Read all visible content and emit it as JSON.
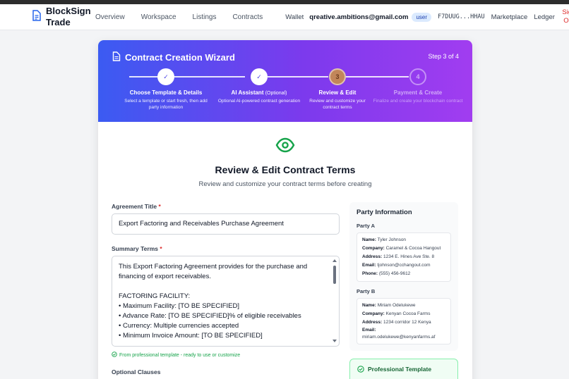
{
  "nav": {
    "brand": "BlockSign Trade",
    "links": [
      "Overview",
      "Workspace",
      "Listings",
      "Contracts"
    ],
    "wallet": "Wallet",
    "email": "qreative.ambitions@gmail.com",
    "role": "user",
    "address": "F7DUUG...HHAU",
    "marketplace": "Marketplace",
    "ledger": "Ledger",
    "signout": "Sign Out"
  },
  "wizard": {
    "title": "Contract Creation Wizard",
    "step_of": "Step 3 of 4",
    "steps": [
      {
        "num": "✓",
        "title": "Choose Template & Details",
        "note": "",
        "desc": "Select a template or start fresh, then add party information"
      },
      {
        "num": "✓",
        "title": "AI Assistant",
        "note": "(Optional)",
        "desc": "Optional AI-powered contract generation"
      },
      {
        "num": "3",
        "title": "Review & Edit",
        "note": "",
        "desc": "Review and customize your contract terms"
      },
      {
        "num": "4",
        "title": "Payment & Create",
        "note": "",
        "desc": "Finalize and create your blockchain contract"
      }
    ]
  },
  "review": {
    "title": "Review & Edit Contract Terms",
    "subtitle": "Review and customize your contract terms before creating",
    "agreement_label": "Agreement Title",
    "agreement_value": "Export Factoring and Receivables Purchase Agreement",
    "summary_label": "Summary Terms",
    "summary_lines": [
      "This Export Factoring Agreement provides for the purchase and",
      "financing of export receivables.",
      "",
      "FACTORING FACILITY:",
      "• Maximum Facility: [TO BE SPECIFIED]",
      "• Advance Rate: [TO BE SPECIFIED]% of eligible receivables",
      "• Currency: Multiple currencies accepted",
      "• Minimum Invoice Amount: [TO BE SPECIFIED]"
    ],
    "template_hint": "From professional template - ready to use or customize",
    "optional_clauses": "Optional Clauses",
    "required_mark": "*"
  },
  "party_info": {
    "title": "Party Information",
    "party_a": {
      "label": "Party A",
      "name_k": "Name:",
      "name": "Tyler Johnson",
      "company_k": "Company:",
      "company": "Caramel & Cocoa Hangout",
      "address_k": "Address:",
      "address": "1234 E. Hines Ave Ste. 8",
      "email_k": "Email:",
      "email": "tjohnson@cchangout.com",
      "phone_k": "Phone:",
      "phone": "(555) 456-9612"
    },
    "party_b": {
      "label": "Party B",
      "name_k": "Name:",
      "name": "Miriam Odelukewe",
      "company_k": "Company:",
      "company": "Kenyan Cocoa Farms",
      "address_k": "Address:",
      "address": "1234 corridor 12 Kenya",
      "email_k": "Email:",
      "email": "miriam.odelukewe@kenyanfarms.af"
    }
  },
  "professional_template": "Professional Template",
  "colors": {
    "accent_start": "#3b5bf2",
    "accent_end": "#a13df0",
    "success": "#16a34a",
    "danger": "#dc2626"
  }
}
